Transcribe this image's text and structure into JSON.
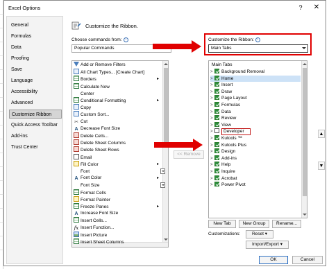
{
  "dialog": {
    "title": "Excel Options",
    "help_glyph": "?",
    "close_glyph": "✕"
  },
  "nav": {
    "items": [
      {
        "label": "General"
      },
      {
        "label": "Formulas"
      },
      {
        "label": "Data"
      },
      {
        "label": "Proofing"
      },
      {
        "label": "Save"
      },
      {
        "label": "Language"
      },
      {
        "label": "Accessibility"
      },
      {
        "label": "Advanced"
      },
      {
        "label": "Customize Ribbon",
        "selected": true
      },
      {
        "label": "Quick Access Toolbar"
      },
      {
        "label": "Add-ins"
      },
      {
        "label": "Trust Center"
      }
    ]
  },
  "main": {
    "heading": "Customize the Ribbon.",
    "choose_label": "Choose commands from:",
    "choose_value": "Popular Commands",
    "customize_label": "Customize the Ribbon:",
    "customize_value": "Main Tabs",
    "info_glyph": "i"
  },
  "commands": [
    {
      "label": "Add or Remove Filters",
      "icon": "filter-icon"
    },
    {
      "label": "All Chart Types... [Create Chart]",
      "icon": "chart-icon"
    },
    {
      "label": "Borders",
      "icon": "borders-icon",
      "submenu": true
    },
    {
      "label": "Calculate Now",
      "icon": "calculate-icon"
    },
    {
      "label": "Center",
      "icon": "center-icon"
    },
    {
      "label": "Conditional Formatting",
      "icon": "conditional-formatting-icon",
      "submenu": true
    },
    {
      "label": "Copy",
      "icon": "copy-icon"
    },
    {
      "label": "Custom Sort...",
      "icon": "sort-icon"
    },
    {
      "label": "Cut",
      "icon": "scissors-icon"
    },
    {
      "label": "Decrease Font Size",
      "icon": "decrease-font-icon"
    },
    {
      "label": "Delete Cells...",
      "icon": "delete-cells-icon"
    },
    {
      "label": "Delete Sheet Columns",
      "icon": "delete-columns-icon"
    },
    {
      "label": "Delete Sheet Rows",
      "icon": "delete-rows-icon"
    },
    {
      "label": "Email",
      "icon": "email-icon"
    },
    {
      "label": "Fill Color",
      "icon": "fill-color-icon",
      "submenu": true
    },
    {
      "label": "Font",
      "icon": "none",
      "minidrop": true
    },
    {
      "label": "Font Color",
      "icon": "font-color-icon",
      "submenu": true
    },
    {
      "label": "Font Size",
      "icon": "none",
      "minidrop": true
    },
    {
      "label": "Format Cells",
      "icon": "format-cells-icon"
    },
    {
      "label": "Format Painter",
      "icon": "format-painter-icon"
    },
    {
      "label": "Freeze Panes",
      "icon": "freeze-panes-icon",
      "submenu": true
    },
    {
      "label": "Increase Font Size",
      "icon": "increase-font-icon"
    },
    {
      "label": "Insert Cells...",
      "icon": "insert-cells-icon"
    },
    {
      "label": "Insert Function...",
      "icon": "fx-icon"
    },
    {
      "label": "Insert Picture",
      "icon": "picture-icon"
    },
    {
      "label": "Insert Sheet Columns",
      "icon": "insert-columns-icon"
    }
  ],
  "remove_button": "<< Remove",
  "tree": {
    "header": "Main Tabs",
    "items": [
      {
        "label": "Background Removal",
        "checked": true
      },
      {
        "label": "Home",
        "checked": true,
        "selected": true
      },
      {
        "label": "Insert",
        "checked": true
      },
      {
        "label": "Draw",
        "checked": true
      },
      {
        "label": "Page Layout",
        "checked": true
      },
      {
        "label": "Formulas",
        "checked": true
      },
      {
        "label": "Data",
        "checked": true
      },
      {
        "label": "Review",
        "checked": true
      },
      {
        "label": "View",
        "checked": true
      },
      {
        "label": "Developer",
        "checked": false,
        "highlight": true
      },
      {
        "label": "Kutools ™",
        "checked": true
      },
      {
        "label": "Kutools Plus",
        "checked": true
      },
      {
        "label": "Design",
        "checked": true
      },
      {
        "label": "Add-ins",
        "checked": true
      },
      {
        "label": "Help",
        "checked": true
      },
      {
        "label": "Inquire",
        "checked": true
      },
      {
        "label": "Acrobat",
        "checked": true
      },
      {
        "label": "Power Pivot",
        "checked": true
      }
    ]
  },
  "tree_buttons": {
    "new_tab": "New Tab",
    "new_group": "New Group",
    "rename": "Rename..."
  },
  "customizations": {
    "label": "Customizations:",
    "reset": "Reset ▾",
    "import_export": "Import/Export ▾"
  },
  "footer": {
    "ok": "OK",
    "cancel": "Cancel"
  },
  "movers": {
    "up": "▲",
    "down": "▼"
  },
  "colors": {
    "accent_red": "#e00000",
    "check_green": "#2d8c3c",
    "selection_blue": "#cde2f7"
  }
}
